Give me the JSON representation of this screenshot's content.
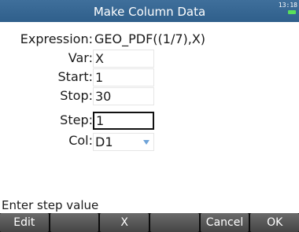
{
  "title": "Make Column Data",
  "status": {
    "time": "13:18",
    "battery_color": "#5adf5a"
  },
  "form": {
    "expression": {
      "label": "Expression:",
      "value": "GEO_PDF((1/7),X)"
    },
    "var": {
      "label": "Var:",
      "value": "X"
    },
    "start": {
      "label": "Start:",
      "value": "1"
    },
    "stop": {
      "label": "Stop:",
      "value": "30"
    },
    "step": {
      "label": "Step:",
      "value": "1"
    },
    "col": {
      "label": "Col:",
      "value": "D1"
    }
  },
  "hint": "Enter step value",
  "menu": [
    "Edit",
    "",
    "X",
    "",
    "Cancel",
    "OK"
  ],
  "colors": {
    "title_bar": "#3f6f9b",
    "menu_bg": "#0c0c0c",
    "button": "#5a5a5a"
  }
}
